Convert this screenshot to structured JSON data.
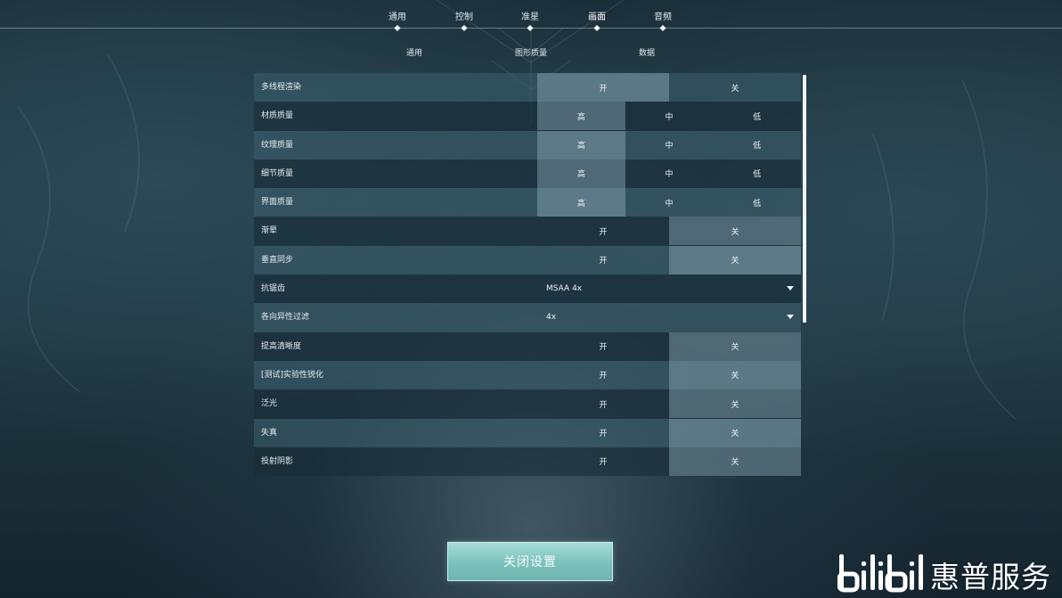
{
  "top_tabs": [
    {
      "label": "通用"
    },
    {
      "label": "控制"
    },
    {
      "label": "准星"
    },
    {
      "label": "画面"
    },
    {
      "label": "音频"
    }
  ],
  "active_top_tab": "画面",
  "sub_tabs": [
    {
      "label": "通用"
    },
    {
      "label": "图形质量"
    },
    {
      "label": "数据"
    }
  ],
  "active_sub_tab": "图形质量",
  "settings": [
    {
      "label": "多线程渲染",
      "type": "toggle",
      "options": [
        "开",
        "关"
      ],
      "selected": "开"
    },
    {
      "label": "材质质量",
      "type": "choice",
      "options": [
        "高",
        "中",
        "低"
      ],
      "selected": "高"
    },
    {
      "label": "纹理质量",
      "type": "choice",
      "options": [
        "高",
        "中",
        "低"
      ],
      "selected": "高"
    },
    {
      "label": "细节质量",
      "type": "choice",
      "options": [
        "高",
        "中",
        "低"
      ],
      "selected": "高"
    },
    {
      "label": "界面质量",
      "type": "choice",
      "options": [
        "高",
        "中",
        "低"
      ],
      "selected": "高"
    },
    {
      "label": "渐晕",
      "type": "toggle",
      "options": [
        "开",
        "关"
      ],
      "selected": "关"
    },
    {
      "label": "垂直同步",
      "type": "toggle",
      "options": [
        "开",
        "关"
      ],
      "selected": "关"
    },
    {
      "label": "抗锯齿",
      "type": "dropdown",
      "value": "MSAA 4x"
    },
    {
      "label": "各向异性过滤",
      "type": "dropdown",
      "value": "4x"
    },
    {
      "label": "提高清晰度",
      "type": "toggle",
      "options": [
        "开",
        "关"
      ],
      "selected": "关"
    },
    {
      "label": "[测试]实验性锐化",
      "type": "toggle",
      "options": [
        "开",
        "关"
      ],
      "selected": "关"
    },
    {
      "label": "泛光",
      "type": "toggle",
      "options": [
        "开",
        "关"
      ],
      "selected": "关"
    },
    {
      "label": "失真",
      "type": "toggle",
      "options": [
        "开",
        "关"
      ],
      "selected": "关"
    },
    {
      "label": "投射阴影",
      "type": "toggle",
      "options": [
        "开",
        "关"
      ],
      "selected": "关"
    }
  ],
  "close_button": {
    "label": "关闭设置"
  },
  "watermark": {
    "brand": "bilibili",
    "text": "惠普服务"
  },
  "colors": {
    "accent": "#7ec3bd",
    "row_light": "#3c5f6e",
    "row_dark": "#182c37"
  }
}
